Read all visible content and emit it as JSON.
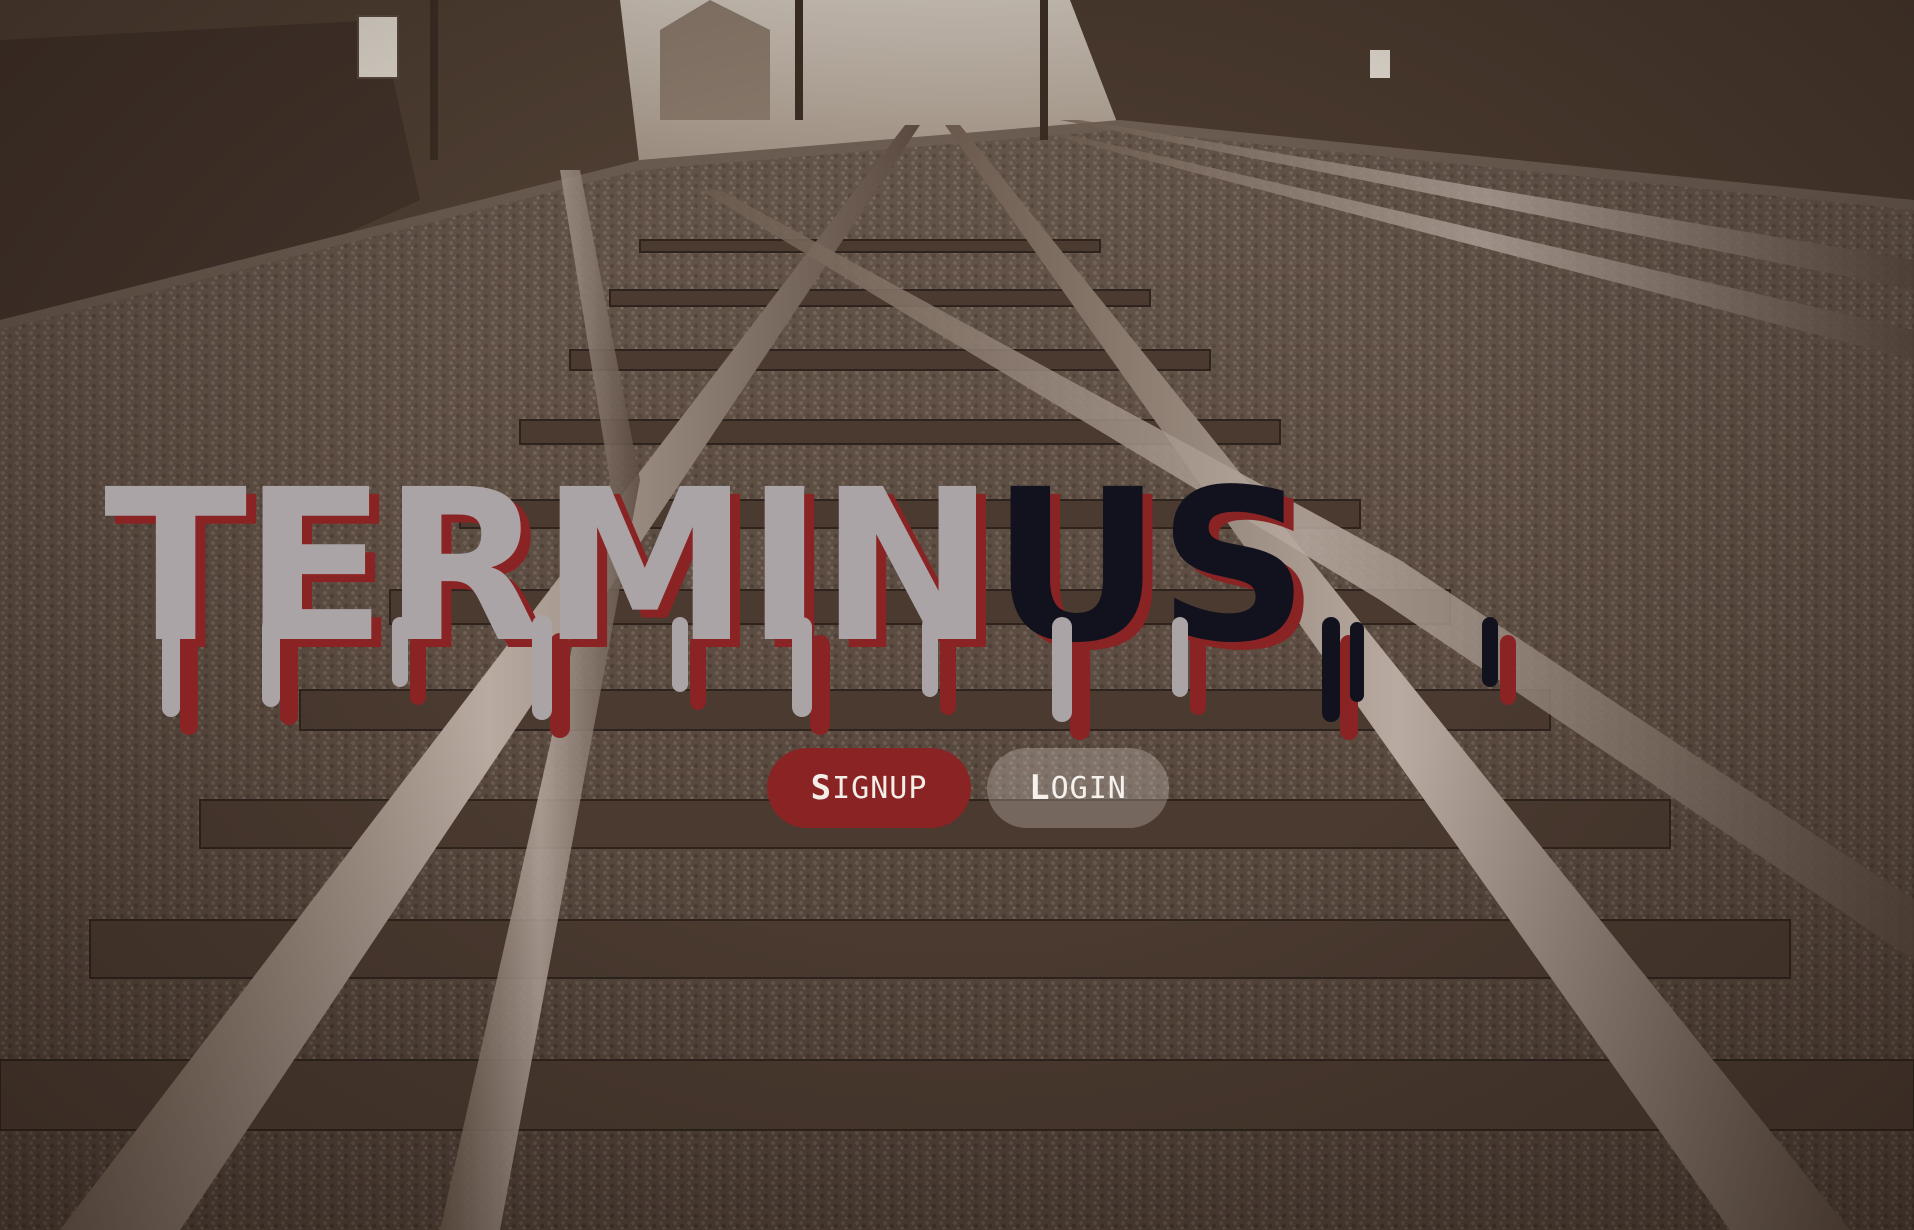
{
  "app": {
    "title": {
      "light_part": "TERMIN",
      "dark_part": "US"
    }
  },
  "actions": {
    "signup": {
      "label_first": "S",
      "label_rest": "IGNUP"
    },
    "login": {
      "label_first": "L",
      "label_rest": "OGIN"
    }
  },
  "colors": {
    "title_light": "#aba4a6",
    "title_dark": "#12121f",
    "title_shadow": "#8a2424",
    "signup_bg": "#8a2424",
    "login_bg": "rgba(230,222,215,0.28)",
    "button_text": "#f3ede8"
  },
  "background": {
    "scene": "railway-tracks-sepia"
  }
}
